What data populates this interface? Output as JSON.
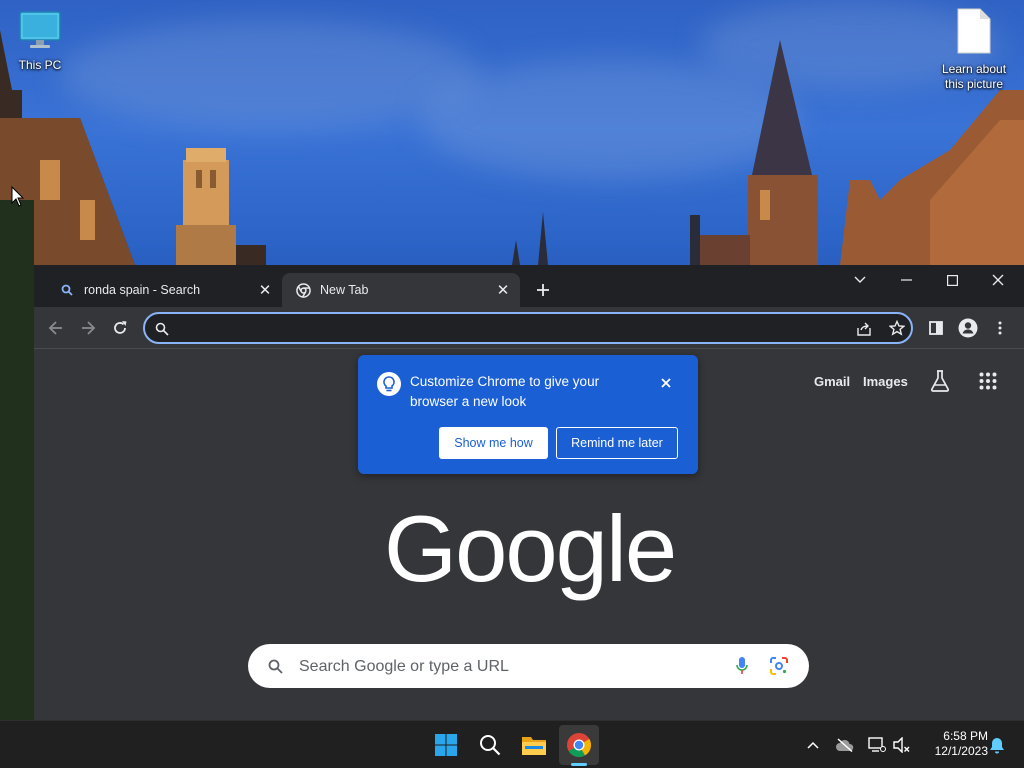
{
  "desktop": {
    "icons": [
      {
        "label": "This PC",
        "icon": "monitor-icon"
      },
      {
        "label": "Learn about this picture",
        "icon": "document-icon"
      }
    ]
  },
  "browser": {
    "tabs": [
      {
        "title": "ronda spain - Search",
        "icon": "search-icon",
        "active": false
      },
      {
        "title": "New Tab",
        "icon": "chrome-icon",
        "active": true
      }
    ],
    "omnibox": {
      "value": "",
      "placeholder": ""
    },
    "new_tab_page": {
      "links": {
        "gmail": "Gmail",
        "images": "Images"
      },
      "bubble": {
        "text": "Customize Chrome to give your browser a new look",
        "primary_button": "Show me how",
        "secondary_button": "Remind me later"
      },
      "logo": "Google",
      "search": {
        "placeholder": "Search Google or type a URL",
        "value": ""
      }
    }
  },
  "taskbar": {
    "apps": [
      "windows-start-icon",
      "search-icon",
      "file-explorer-icon",
      "chrome-icon"
    ],
    "clock": {
      "time": "6:58 PM",
      "date": "12/1/2023"
    }
  },
  "colors": {
    "accent_blue": "#1a5fd3",
    "focus_ring": "#8ab4f8",
    "browser_frame": "#202124",
    "browser_surface": "#35363a",
    "taskbar": "#202020"
  }
}
